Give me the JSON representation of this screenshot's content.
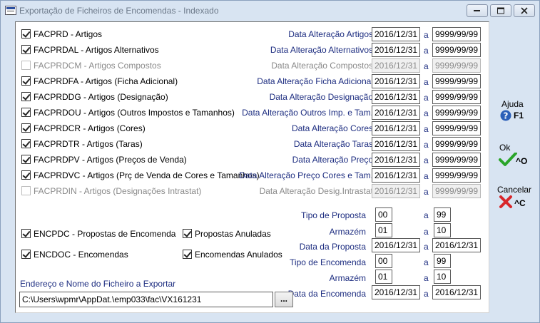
{
  "window": {
    "title": "Exportação de Ficheiros de Encomendas - Indexado"
  },
  "rows": [
    {
      "check_label": "FACPRD - Artigos",
      "range_label": "Data Alteração Artigos",
      "from": "2016/12/31",
      "to": "9999/99/99",
      "checked": true,
      "enabled": true
    },
    {
      "check_label": "FACPRDAL - Artigos Alternativos",
      "range_label": "Data Alteração Alternativos",
      "from": "2016/12/31",
      "to": "9999/99/99",
      "checked": true,
      "enabled": true
    },
    {
      "check_label": "FACPRDCM - Artigos Compostos",
      "range_label": "Data Alteração Compostos",
      "from": "2016/12/31",
      "to": "9999/99/99",
      "checked": false,
      "enabled": false
    },
    {
      "check_label": "FACPRDFA - Artigos (Ficha Adicional)",
      "range_label": "Data Alteração Ficha Adicional",
      "from": "2016/12/31",
      "to": "9999/99/99",
      "checked": true,
      "enabled": true
    },
    {
      "check_label": "FACPRDDG - Artigos (Designação)",
      "range_label": "Data Alteração Designação",
      "from": "2016/12/31",
      "to": "9999/99/99",
      "checked": true,
      "enabled": true
    },
    {
      "check_label": "FACPRDOU - Artigos (Outros Impostos e Tamanhos)",
      "range_label": "Data Alteração Outros Imp. e Tam.",
      "from": "2016/12/31",
      "to": "9999/99/99",
      "checked": true,
      "enabled": true
    },
    {
      "check_label": "FACPRDCR - Artigos (Cores)",
      "range_label": "Data Alteração Cores",
      "from": "2016/12/31",
      "to": "9999/99/99",
      "checked": true,
      "enabled": true
    },
    {
      "check_label": "FACPRDTR - Artigos (Taras)",
      "range_label": "Data Alteração Taras",
      "from": "2016/12/31",
      "to": "9999/99/99",
      "checked": true,
      "enabled": true
    },
    {
      "check_label": "FACPRDPV - Artigos (Preços de Venda)",
      "range_label": "Data Alteração Preço",
      "from": "2016/12/31",
      "to": "9999/99/99",
      "checked": true,
      "enabled": true
    },
    {
      "check_label": "FACPRDVC - Artigos (Prç de Venda de Cores e Tamanhos)",
      "range_label": "Data Alteração Preço Cores e Tam.",
      "from": "2016/12/31",
      "to": "9999/99/99",
      "checked": true,
      "enabled": true
    },
    {
      "check_label": "FACPRDIN - Artigos (Designações Intrastat)",
      "range_label": "Data Alteração Desig.Intrastat",
      "from": "2016/12/31",
      "to": "9999/99/99",
      "checked": false,
      "enabled": false
    }
  ],
  "range_separator": "a",
  "proposals": {
    "tipo_label": "Tipo de Proposta",
    "tipo_from": "00",
    "tipo_to": "99",
    "armazem_label": "Armazém",
    "armazem_from": "01",
    "armazem_to": "10",
    "data_label": "Data da Proposta",
    "data_from": "2016/12/31",
    "data_to": "2016/12/31"
  },
  "orders": {
    "tipo_label": "Tipo de Encomenda",
    "tipo_from": "00",
    "tipo_to": "99",
    "armazem_label": "Armazém",
    "armazem_from": "01",
    "armazem_to": "10",
    "data_label": "Data da Encomenda",
    "data_from": "2016/12/31",
    "data_to": "2016/12/31"
  },
  "options": {
    "encpdc": "ENCPDC - Propostas de Encomenda",
    "encdoc": "ENCDOC - Encomendas",
    "propostas_anuladas": "Propostas Anuladas",
    "encomendas_anuladas": "Encomendas Anulados"
  },
  "file": {
    "label": "Endereço e Nome do Ficheiro a Exportar",
    "path": "C:\\Users\\wpmr\\AppDat.\\emp033\\fac\\VX161231",
    "browse": "..."
  },
  "side": {
    "help_label": "Ajuda",
    "help_key": "F1",
    "ok_label": "Ok",
    "ok_key": "^O",
    "cancel_label": "Cancelar",
    "cancel_key": "^C"
  },
  "colors": {
    "label_blue": "#1d2d80",
    "window_bg": "#d8e4f2",
    "ok_green": "#2aa52a",
    "cancel_red": "#d8262b",
    "help_blue": "#2b5fb8"
  }
}
